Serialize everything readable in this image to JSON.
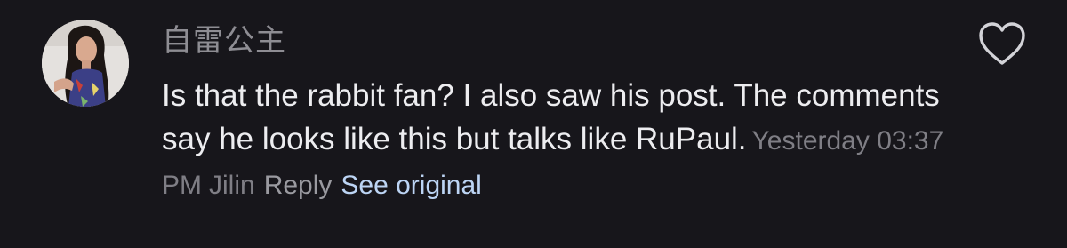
{
  "comment": {
    "username": "自雷公主",
    "text": "Is that the rabbit fan? I also saw his post. The comments say he looks like this but talks like RuPaul.",
    "timestamp": "Yesterday 03:37 PM",
    "location": "Jilin",
    "reply_label": "Reply",
    "see_original_label": "See original",
    "avatar_icon": "user-avatar",
    "like_icon": "heart-outline-icon"
  },
  "colors": {
    "background": "#17161b",
    "body_text": "#ededf0",
    "meta_text": "#7f7e85",
    "link_text": "#bcd4f4"
  }
}
